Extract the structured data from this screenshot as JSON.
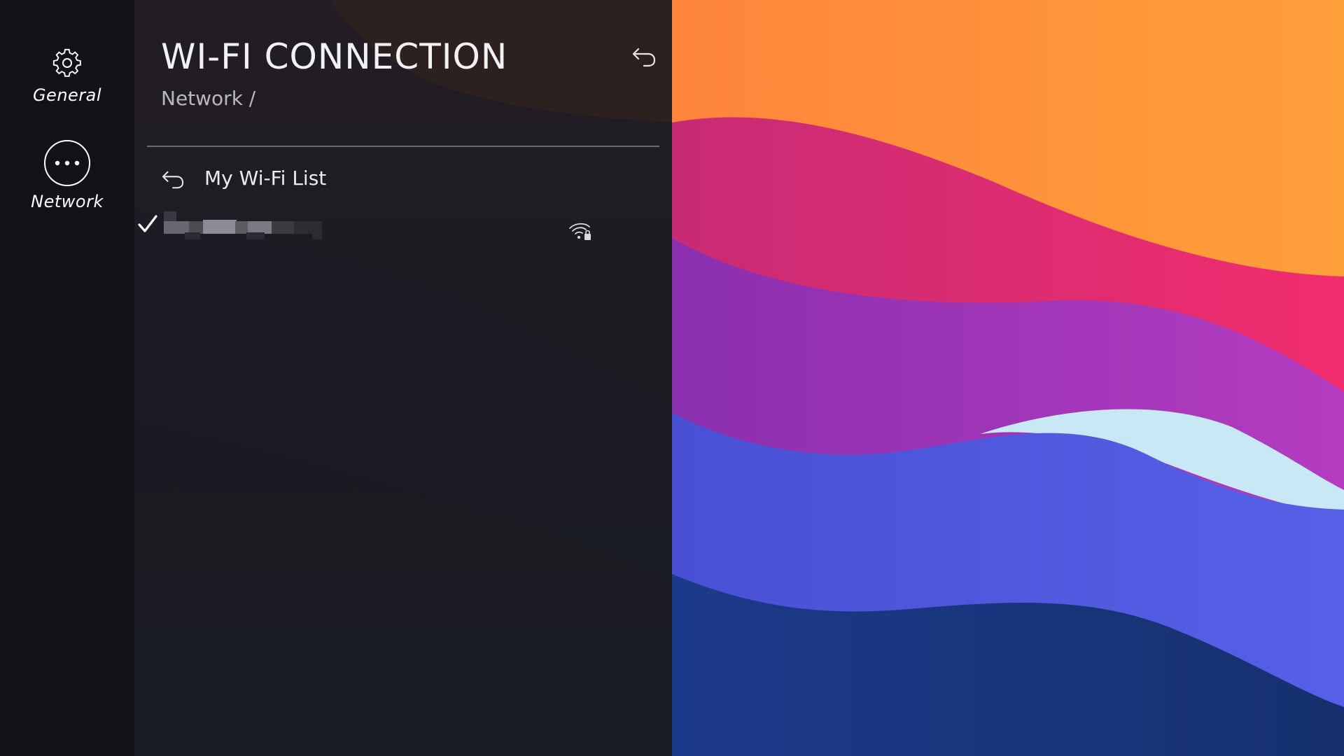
{
  "sidebar": {
    "items": [
      {
        "label": "General",
        "icon": "gear-icon"
      },
      {
        "label": "Network",
        "icon": "more-dots-icon",
        "selected": true
      }
    ]
  },
  "header": {
    "title": "WI-FI CONNECTION",
    "breadcrumb": "Network /",
    "back_icon": "back-arrow-icon"
  },
  "wifi_list": {
    "back_label": "My Wi-Fi List",
    "networks": [
      {
        "ssid": "",
        "ssid_obscured": true,
        "connected": true,
        "secured": true,
        "icon": "wifi-lock-icon"
      }
    ]
  },
  "colors": {
    "rail_bg": "#121218",
    "panel_bg": "#1d1b22",
    "text_primary": "#f2f2f4",
    "text_secondary": "#b8b8bd"
  }
}
